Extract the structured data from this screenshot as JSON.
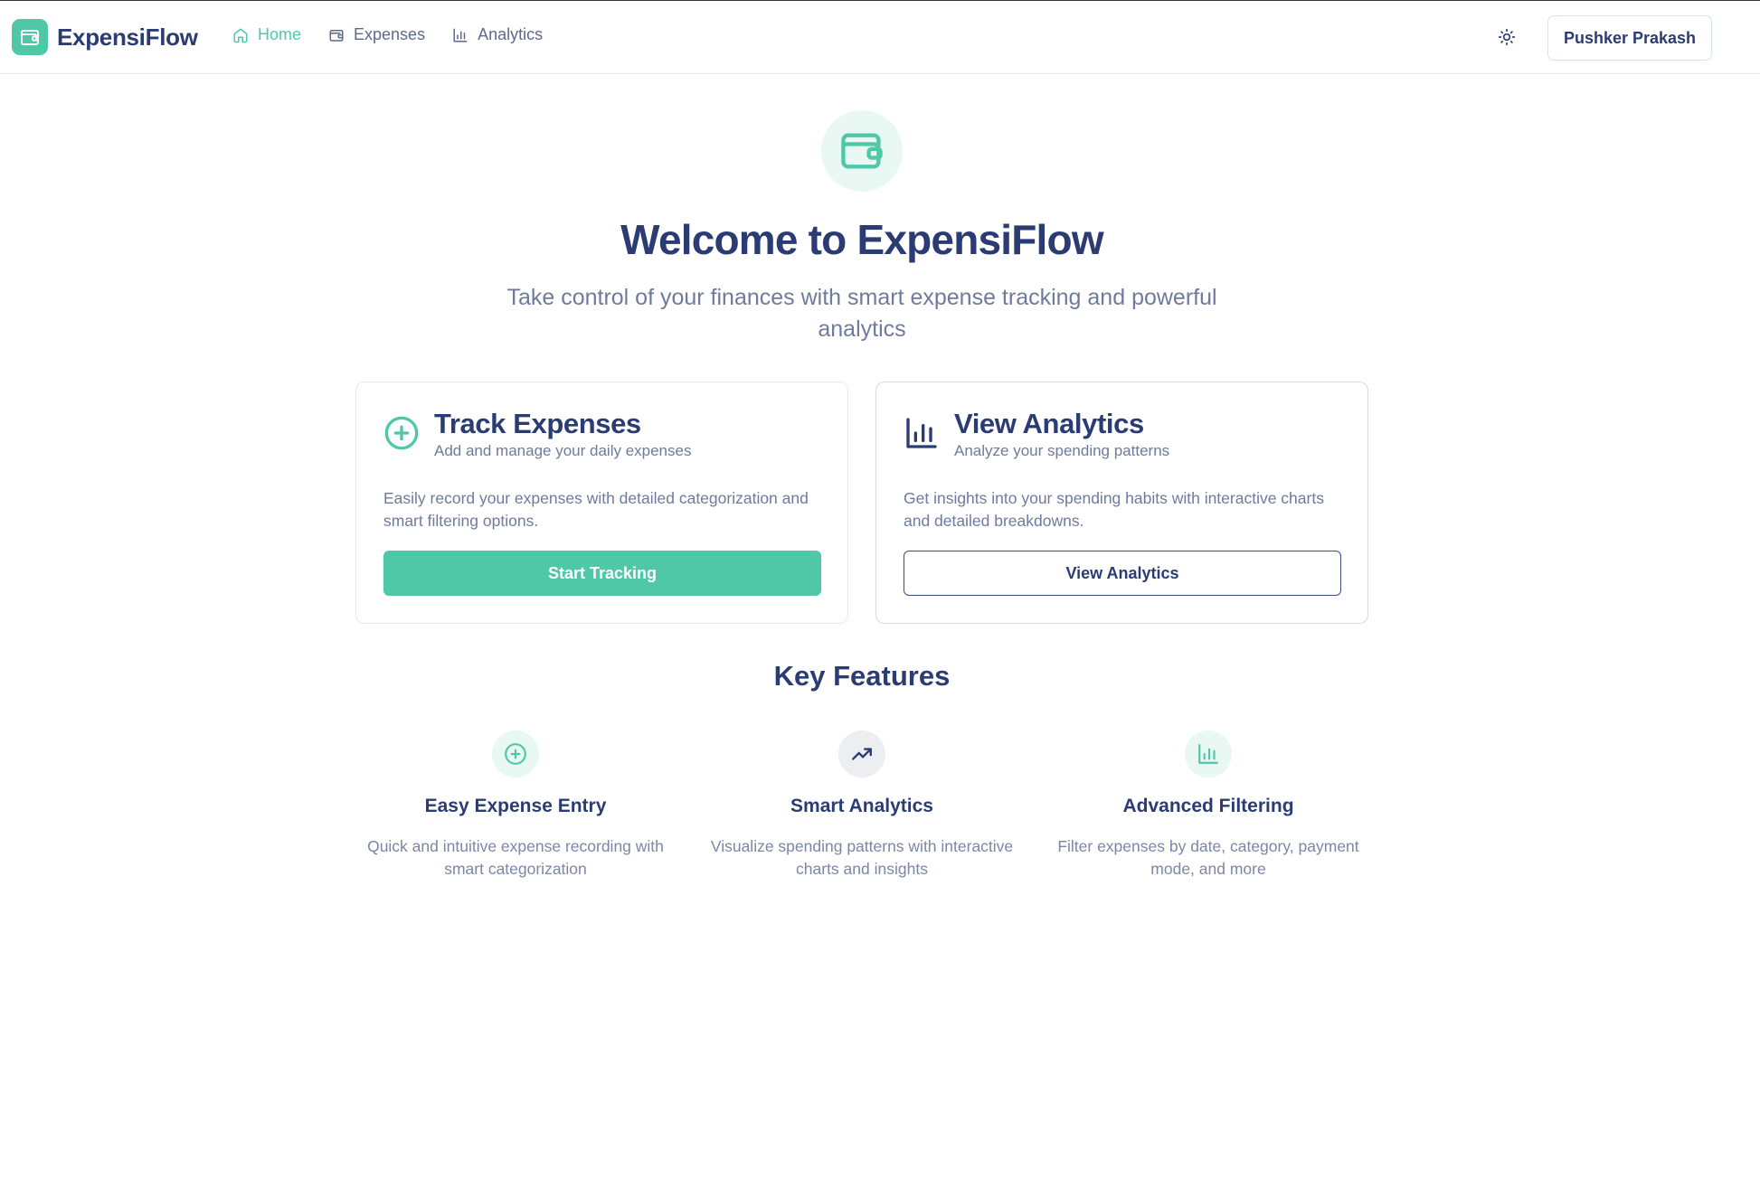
{
  "app": {
    "name": "ExpensiFlow"
  },
  "nav": {
    "items": [
      {
        "label": "Home",
        "icon": "home-icon",
        "active": true
      },
      {
        "label": "Expenses",
        "icon": "wallet-icon",
        "active": false
      },
      {
        "label": "Analytics",
        "icon": "bar-chart-icon",
        "active": false
      }
    ]
  },
  "user": {
    "name": "Pushker Prakash"
  },
  "hero": {
    "title": "Welcome to ExpensiFlow",
    "subtitle": "Take control of your finances with smart expense tracking and powerful analytics",
    "icon": "wallet-icon"
  },
  "cards": {
    "track": {
      "title": "Track Expenses",
      "subtitle": "Add and manage your daily expenses",
      "description": "Easily record your expenses with detailed categorization and smart filtering options.",
      "button": "Start Tracking",
      "icon": "plus-circle-icon"
    },
    "analytics": {
      "title": "View Analytics",
      "subtitle": "Analyze your spending patterns",
      "description": "Get insights into your spending habits with interactive charts and detailed breakdowns.",
      "button": "View Analytics",
      "icon": "bar-chart-icon"
    }
  },
  "features": {
    "title": "Key Features",
    "items": [
      {
        "title": "Easy Expense Entry",
        "description": "Quick and intuitive expense recording with smart categorization",
        "icon": "plus-circle-icon"
      },
      {
        "title": "Smart Analytics",
        "description": "Visualize spending patterns with interactive charts and insights",
        "icon": "trending-up-icon"
      },
      {
        "title": "Advanced Filtering",
        "description": "Filter expenses by date, category, payment mode, and more",
        "icon": "bar-chart-icon"
      }
    ]
  },
  "colors": {
    "accent": "#4fc8a8",
    "navy": "#2a3c73",
    "muted": "#6e7b9c"
  }
}
